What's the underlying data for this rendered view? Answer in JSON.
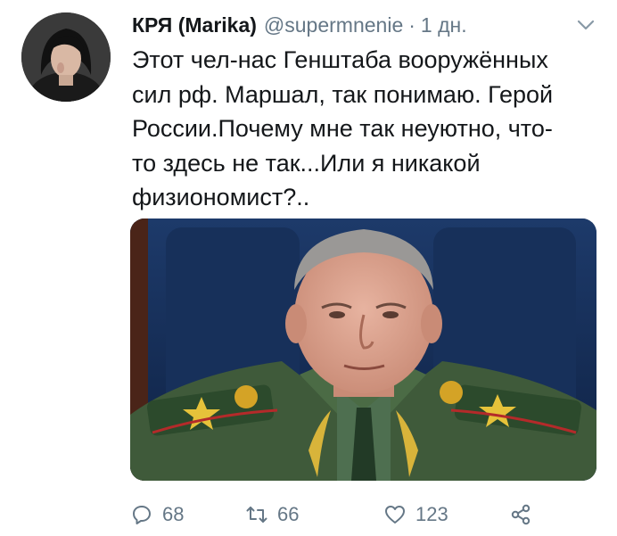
{
  "tweet": {
    "display_name": "КРЯ (Marika)",
    "handle": "@supermnenie",
    "separator": "·",
    "time": "1 дн.",
    "lines": [
      "Этот чел-нас Генштаба вооружённых",
      "сил рф. Маршал, так понимаю. Герой",
      "России.Почему мне так неуютно, что-",
      "то здесь не так...Или я никакой",
      "физиономист?.."
    ]
  },
  "icons": {
    "caret": "chevron-down-icon",
    "reply": "reply-icon",
    "retweet": "retweet-icon",
    "like": "heart-icon",
    "share": "share-icon"
  },
  "actions": {
    "reply_count": "68",
    "retweet_count": "66",
    "like_count": "123"
  },
  "colors": {
    "text": "#14171a",
    "secondary": "#657786"
  }
}
